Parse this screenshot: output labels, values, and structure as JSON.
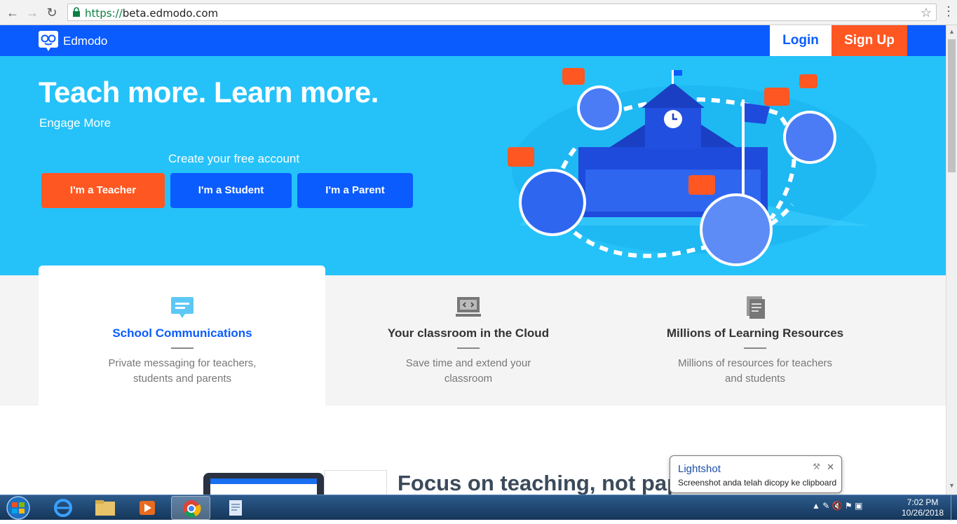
{
  "browser": {
    "url_scheme": "https://",
    "url_host": "beta.edmodo.com"
  },
  "nav": {
    "brand": "Edmodo",
    "login": "Login",
    "signup": "Sign Up"
  },
  "hero": {
    "title": "Teach more. Learn more.",
    "subtitle": "Engage More",
    "create_label": "Create your free account",
    "buttons": [
      "I'm a Teacher",
      "I'm a Student",
      "I'm a Parent"
    ]
  },
  "features": [
    {
      "title": "School Communications",
      "desc": "Private messaging for teachers, students and parents",
      "icon": "chat-icon"
    },
    {
      "title": "Your classroom in the Cloud",
      "desc": "Save time and extend your classroom",
      "icon": "code-screen-icon"
    },
    {
      "title": "Millions of Learning Resources",
      "desc": "Millions of resources for teachers and students",
      "icon": "documents-icon"
    }
  ],
  "lower": {
    "heading": "Focus on teaching, not paperwork."
  },
  "toast": {
    "title": "Lightshot",
    "message": "Screenshot anda telah dicopy ke clipboard"
  },
  "taskbar": {
    "time": "7:02 PM",
    "date": "10/26/2018"
  },
  "colors": {
    "brand_blue": "#0a5cff",
    "hero_bg": "#25c2f9",
    "accent_orange": "#ff5722"
  }
}
